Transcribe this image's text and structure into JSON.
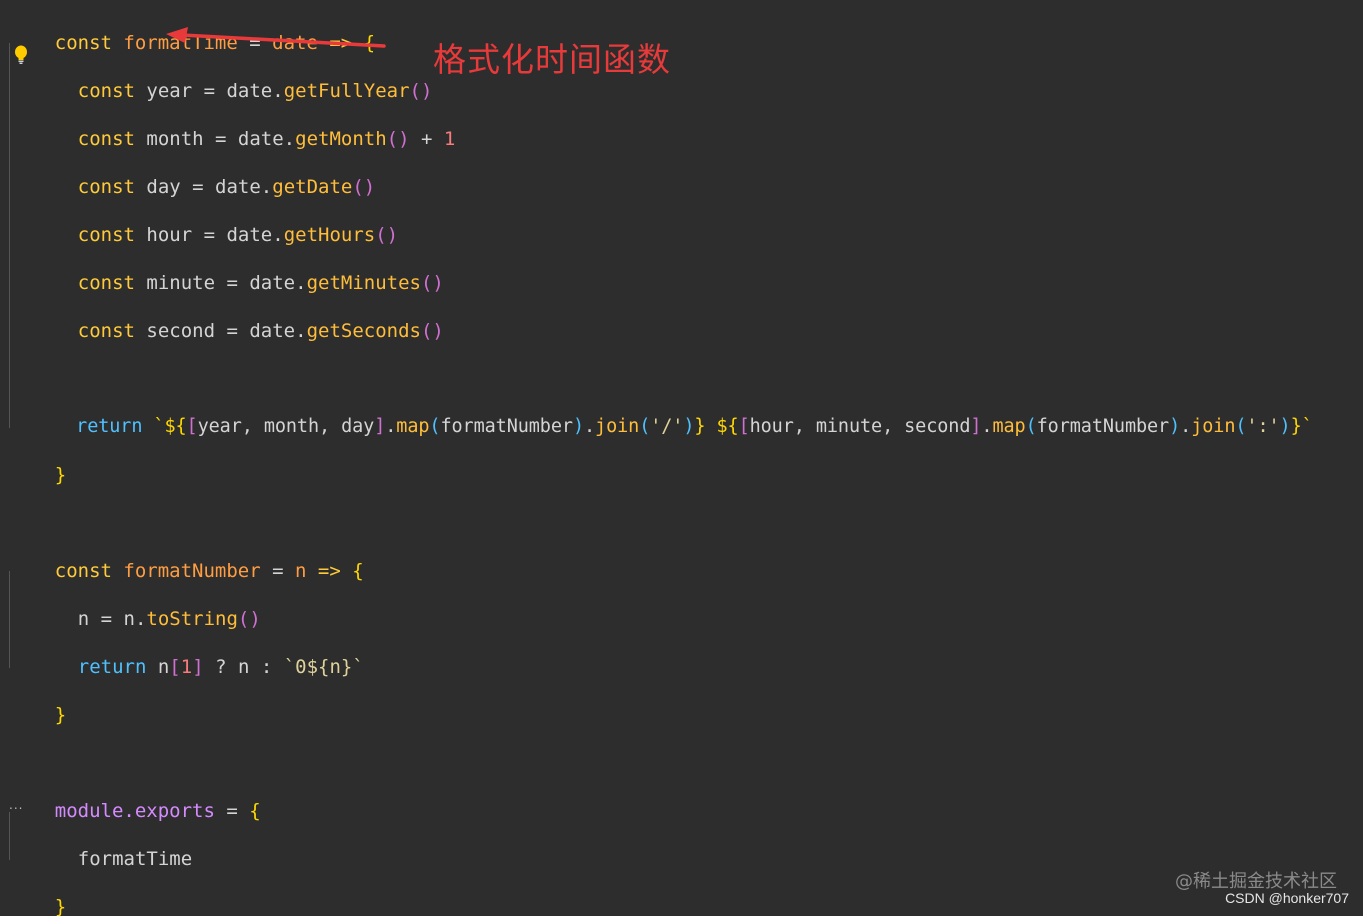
{
  "code": {
    "l1": {
      "kw": "const",
      "name": "formatTime",
      "eq": " = ",
      "param": "date",
      "arrow": " => ",
      "brace": "{"
    },
    "l2": {
      "kw": "const",
      "v": " year = date.",
      "fn": "getFullYear",
      "p": "()"
    },
    "l3": {
      "kw": "const",
      "v": " month = date.",
      "fn": "getMonth",
      "p": "()",
      "op": " + ",
      "num": "1"
    },
    "l4": {
      "kw": "const",
      "v": " day = date.",
      "fn": "getDate",
      "p": "()"
    },
    "l5": {
      "kw": "const",
      "v": " hour = date.",
      "fn": "getHours",
      "p": "()"
    },
    "l6": {
      "kw": "const",
      "v": " minute = date.",
      "fn": "getMinutes",
      "p": "()"
    },
    "l7": {
      "kw": "const",
      "v": " second = date.",
      "fn": "getSeconds",
      "p": "()"
    },
    "l8": {
      "kw": "return",
      "t1": " `${",
      "b1": "[",
      "vars1": "year, month, day",
      "b1c": "]",
      "dot1": ".",
      "map1": "map",
      "po1": "(",
      "arg1": "formatNumber",
      "pc1": ")",
      "dot2": ".",
      "join1": "join",
      "po2": "(",
      "s1": "'/'",
      "pc2": ")",
      "t2": "} ${",
      "b2": "[",
      "vars2": "hour, minute, second",
      "b2c": "]",
      "dot3": ".",
      "map2": "map",
      "po3": "(",
      "arg2": "formatNumber",
      "pc3": ")",
      "dot4": ".",
      "join2": "join",
      "po4": "(",
      "s2": "':'",
      "pc4": ")",
      "t3": "}`"
    },
    "l9": {
      "brace": "}"
    },
    "l10": {
      "kw": "const",
      "name": "formatNumber",
      "eq": " = ",
      "param": "n",
      "arrow": " => ",
      "brace": "{"
    },
    "l11": {
      "v": "n = n.",
      "fn": "toString",
      "p": "()"
    },
    "l12": {
      "kw": "return",
      "v": " n",
      "b": "[",
      "num": "1",
      "bc": "]",
      "rest": " ? n : ",
      "tpl": "`0${n}`"
    },
    "l13": {
      "brace": "}"
    },
    "l14": {
      "mod": "module.exports",
      "eq": " = ",
      "brace": "{"
    },
    "l15": {
      "v": "formatTime"
    },
    "l16": {
      "brace": "}"
    }
  },
  "annotation": {
    "text": "格式化时间函数"
  },
  "fold_dots": "...",
  "watermark": "@稀土掘金技术社区",
  "credit": "CSDN @honker707",
  "icons": {
    "bulb": "lightbulb-icon",
    "arrow": "annotation-arrow"
  },
  "colors": {
    "background": "#2d2d2d",
    "keyword": "#ffcb3b",
    "return": "#4fc1ff",
    "function_name": "#ff9d42",
    "annotation": "#e83a3a"
  }
}
